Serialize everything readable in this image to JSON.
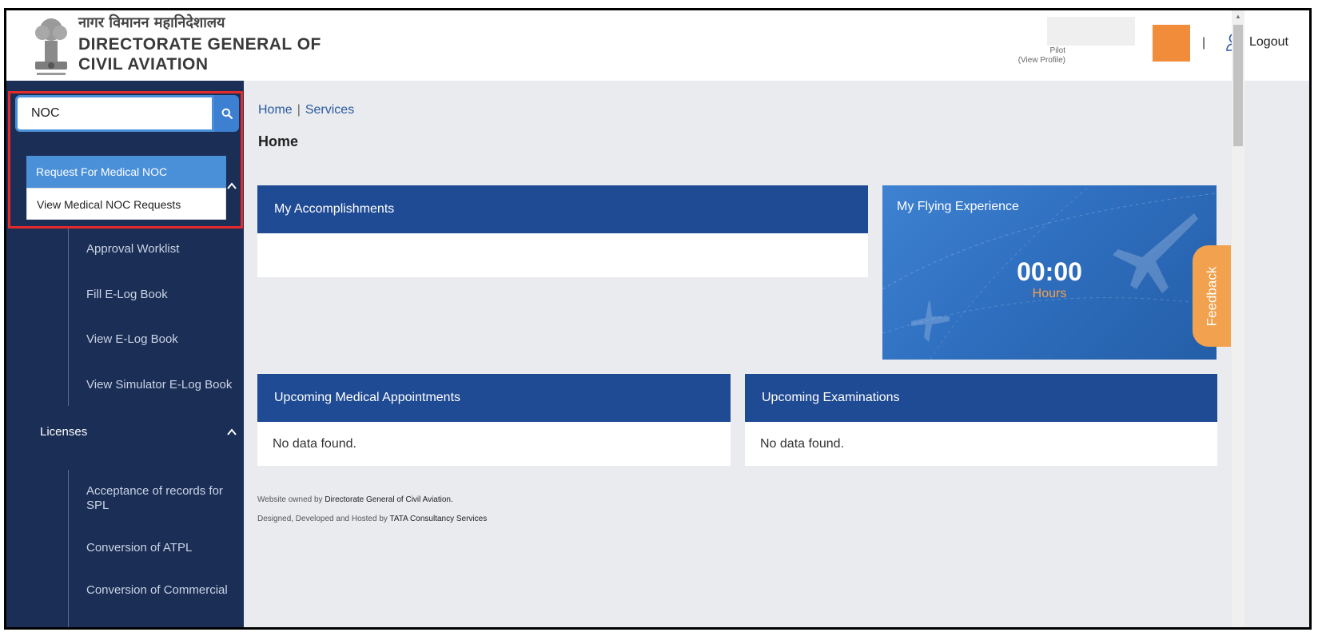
{
  "header": {
    "org_name_hindi": "नागर विमानन महानिदेशालय",
    "org_name_line1": "DIRECTORATE GENERAL OF",
    "org_name_line2": "CIVIL AVIATION",
    "user_role": "Pilot",
    "view_profile": "(View Profile)",
    "separator": "|",
    "logout_label": "Logout"
  },
  "sidebar": {
    "search": {
      "value": "NOC",
      "placeholder": ""
    },
    "suggestions": [
      "Request For Medical NOC",
      "View Medical NOC Requests"
    ],
    "items": [
      "Approval Worklist",
      "Fill E-Log Book",
      "View E-Log Book",
      "View Simulator E-Log Book"
    ],
    "group_licenses": "Licenses",
    "license_items": [
      "Acceptance of records for SPL",
      "Conversion of ATPL",
      "Conversion of Commercial"
    ]
  },
  "breadcrumb": {
    "home": "Home",
    "sep": "|",
    "services": "Services"
  },
  "page_title": "Home",
  "cards": {
    "accomplishments": {
      "title": "My Accomplishments"
    },
    "flying": {
      "title": "My Flying Experience",
      "value": "00:00",
      "unit": "Hours"
    },
    "medical": {
      "title": "Upcoming Medical Appointments",
      "body": "No data found."
    },
    "exams": {
      "title": "Upcoming Examinations",
      "body": "No data found."
    }
  },
  "feedback_label": "Feedback",
  "footer": {
    "line1_prefix": "Website owned by ",
    "line1_org": "Directorate General of Civil Aviation.",
    "line2_prefix": "Designed, Developed and Hosted by ",
    "line2_org": "TATA Consultancy Services"
  },
  "colors": {
    "sidebar_bg": "#1b2e55",
    "card_header": "#1f4a94",
    "accent_orange": "#f08c3a",
    "highlight_red": "#e32b2b"
  }
}
